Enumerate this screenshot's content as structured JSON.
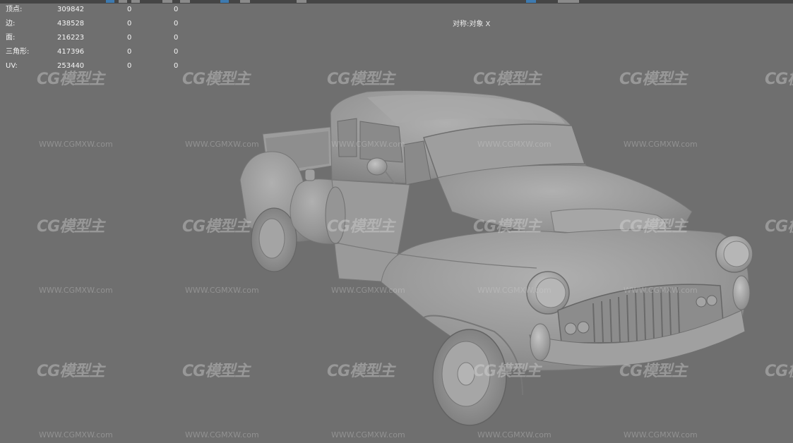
{
  "stats": {
    "rows": [
      {
        "label": "顶点:",
        "v1": "309842",
        "v2": "0",
        "v3": "0"
      },
      {
        "label": "边:",
        "v1": "438528",
        "v2": "0",
        "v3": "0"
      },
      {
        "label": "面:",
        "v1": "216223",
        "v2": "0",
        "v3": "0"
      },
      {
        "label": "三角形:",
        "v1": "417396",
        "v2": "0",
        "v3": "0"
      },
      {
        "label": "UV:",
        "v1": "253440",
        "v2": "0",
        "v3": "0"
      }
    ]
  },
  "symmetry": {
    "label": "对称:对象 X"
  },
  "watermark": {
    "logo": "CG模型主",
    "url": "WWW.CGMXW.com"
  },
  "colors": {
    "viewport_bg": "#6f6f6f",
    "model": "#9a9a9a",
    "toolbar_accent": "#3d7ab0"
  }
}
